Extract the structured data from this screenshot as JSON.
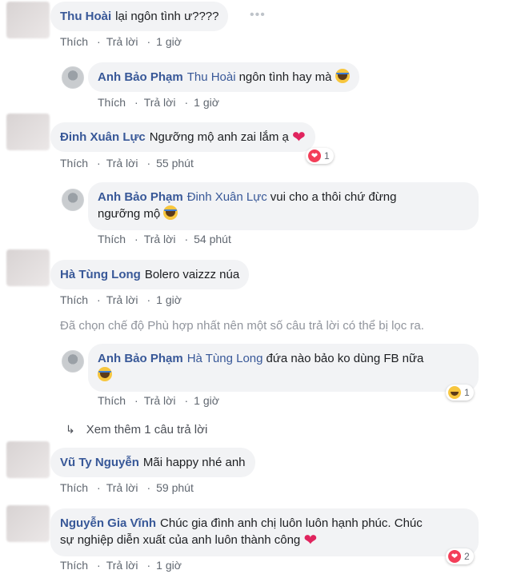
{
  "actions": {
    "like": "Thích",
    "reply": "Trả lời"
  },
  "comments": [
    {
      "author": "Thu Hoài",
      "text": "lại ngôn tình ư????",
      "time": "1 giờ"
    },
    {
      "author": "Anh Bảo Phạm",
      "tag": "Thu Hoài",
      "text": "ngôn tình hay mà",
      "emoji": "laugh-icon",
      "time": "1 giờ"
    },
    {
      "author": "Đinh Xuân Lực",
      "text": "Ngưỡng mộ anh zai lắm ạ",
      "emoji": "heart-icon",
      "time": "55 phút",
      "reaction_count": "1",
      "reaction": "heart"
    },
    {
      "author": "Anh Bảo Phạm",
      "tag": "Đinh Xuân Lực",
      "text": "vui cho a thôi chứ đừng",
      "text2": "ngưỡng mộ",
      "emoji": "laugh-icon",
      "time": "54 phút"
    },
    {
      "author": "Hà Tùng Long",
      "text": "Bolero vaizzz núa",
      "time": "1 giờ"
    },
    {
      "author": "Anh Bảo Phạm",
      "tag": "Hà Tùng Long",
      "text": "đứa nào bảo ko dùng FB nữa",
      "emoji": "laugh-icon",
      "time": "1 giờ",
      "reaction_count": "1",
      "reaction": "haha"
    },
    {
      "author": "Vũ Ty Nguyễn",
      "text": "Mãi happy nhé anh",
      "time": "59 phút"
    },
    {
      "author": "Nguyễn Gia Vĩnh",
      "text": "Chúc gia đình anh chị luôn luôn hạnh phúc. Chúc",
      "text2": "sự nghiệp diễn xuất của anh luôn thành công",
      "emoji": "heart-icon",
      "time": "1 giờ",
      "reaction_count": "2",
      "reaction": "heart"
    }
  ],
  "notice": "Đã chọn chế độ Phù hợp nhất nên một số câu trả lời có thể bị lọc ra.",
  "more_replies": "Xem thêm 1 câu trả lời",
  "more_icon": "reply-arrow-icon",
  "options_icon": "more-options-icon"
}
